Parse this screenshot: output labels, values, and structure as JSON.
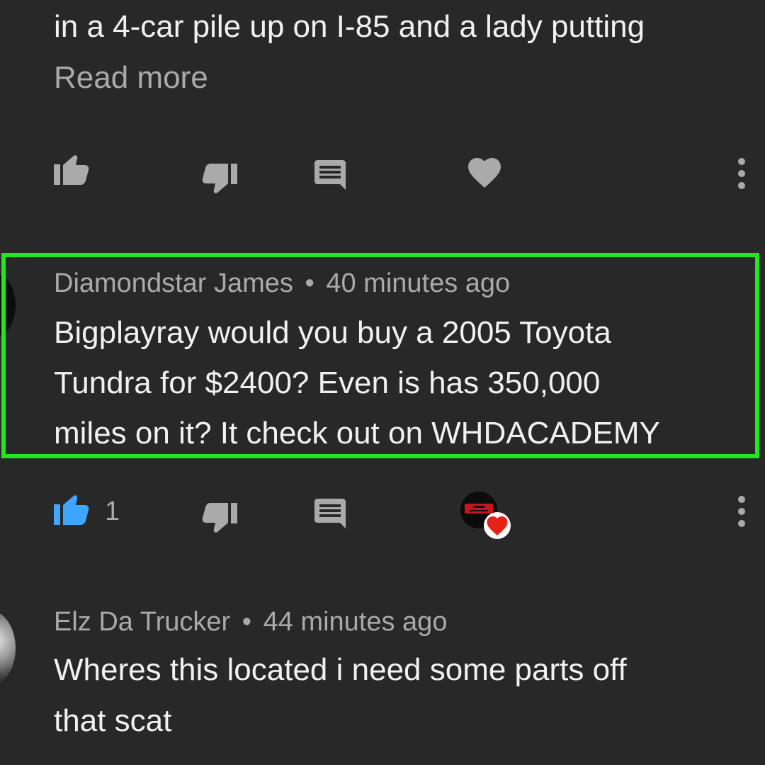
{
  "comment_prev": {
    "text_tail": "in a 4-car pile up on I-85 and a lady putting",
    "read_more": "Read more"
  },
  "comment_1": {
    "author": "Diamondstar James",
    "separator": "•",
    "time": "40 minutes ago",
    "lines": [
      "Bigplayray would you buy a 2005 Toyota",
      "Tundra for $2400? Even is has 350,000",
      "miles on it? It check out on WHDACADEMY"
    ],
    "like_count": "1"
  },
  "comment_2": {
    "author": "Elz Da Trucker",
    "separator": "•",
    "time": "44 minutes ago",
    "lines": [
      "Wheres this located i need some parts off",
      "that scat"
    ]
  },
  "colors": {
    "background": "#282828",
    "text_primary": "#f1f1f1",
    "text_secondary": "#aaaaaa",
    "like_active": "#3ea6ff",
    "heart_creator": "#e62117",
    "highlight_box": "#1fe81f"
  },
  "icons": {
    "like": "thumb-up-icon",
    "dislike": "thumb-down-icon",
    "reply": "reply-icon",
    "heart": "heart-icon",
    "more": "more-vert-icon"
  }
}
